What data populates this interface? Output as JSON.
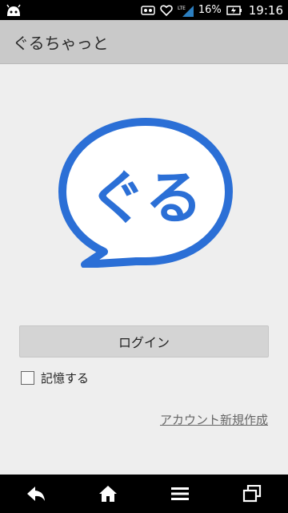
{
  "status_bar": {
    "network": "LTE",
    "battery": "16%",
    "time": "19:16"
  },
  "app_bar": {
    "title": "ぐるちゃっと"
  },
  "logo": {
    "text": "ぐる",
    "color": "#2b6fd6"
  },
  "login": {
    "label": "ログイン"
  },
  "remember": {
    "label": "記憶する",
    "checked": false
  },
  "create_account": {
    "label": "アカウント新規作成"
  },
  "nav_bar": {
    "icons": [
      "back-icon",
      "home-icon",
      "menu-icon",
      "recent-apps-icon"
    ]
  }
}
